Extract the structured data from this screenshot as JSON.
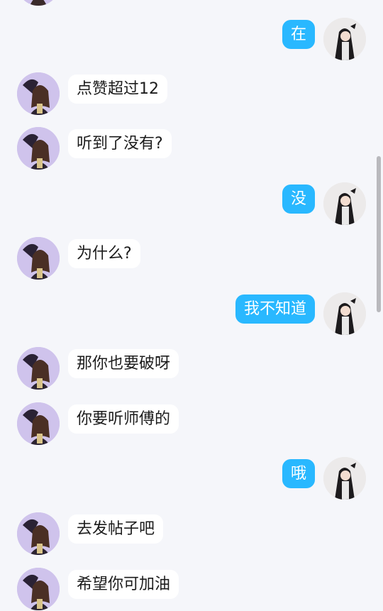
{
  "conversation": {
    "messages": [
      {
        "side": "right",
        "text": "在"
      },
      {
        "side": "left",
        "text": "点赞超过12"
      },
      {
        "side": "left",
        "text": "听到了没有?"
      },
      {
        "side": "right",
        "text": "没"
      },
      {
        "side": "left",
        "text": "为什么?"
      },
      {
        "side": "right",
        "text": "我不知道"
      },
      {
        "side": "left",
        "text": "那你也要破呀"
      },
      {
        "side": "left",
        "text": "你要听师傅的"
      },
      {
        "side": "right",
        "text": "哦"
      },
      {
        "side": "left",
        "text": "去发帖子吧"
      },
      {
        "side": "left",
        "text": "希望你可加油"
      }
    ]
  },
  "colors": {
    "background": "#f5f6fa",
    "sent_bubble": "#29b8ff",
    "received_bubble": "#ffffff",
    "sent_text": "#ffffff",
    "received_text": "#1c1c1c"
  },
  "icons": {
    "sender_avatar": "avatar-icon",
    "self_avatar": "avatar-icon"
  }
}
